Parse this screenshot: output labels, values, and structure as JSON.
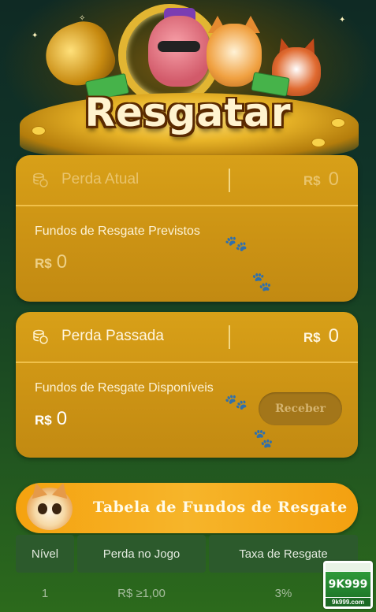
{
  "hero": {
    "title": "Resgatar"
  },
  "current_loss": {
    "label": "Perda Atual",
    "currency": "R$",
    "value": "0",
    "sub_label": "Fundos de Resgate Previstos",
    "amount_currency": "R$",
    "amount_value": "0"
  },
  "past_loss": {
    "label": "Perda Passada",
    "currency": "R$",
    "value": "0",
    "sub_label": "Fundos de Resgate Disponíveis",
    "amount_currency": "R$",
    "amount_value": "0",
    "button_label": "Receber"
  },
  "rescue_table": {
    "title": "Tabela de Fundos de Resgate",
    "headers": [
      "Nível",
      "Perda no Jogo",
      "Taxa de Resgate"
    ],
    "rows": [
      {
        "level": "1",
        "loss": "R$ ≥1,00",
        "rate": "3%"
      }
    ]
  },
  "watermark": {
    "brand": "9K999",
    "site": "9k999.com"
  },
  "colors": {
    "card": "#cc9314",
    "banner": "#f5a20f",
    "background": "#103428"
  },
  "icons": [
    "coin-stack-icon",
    "paw-icon",
    "cat-avatar-icon"
  ]
}
